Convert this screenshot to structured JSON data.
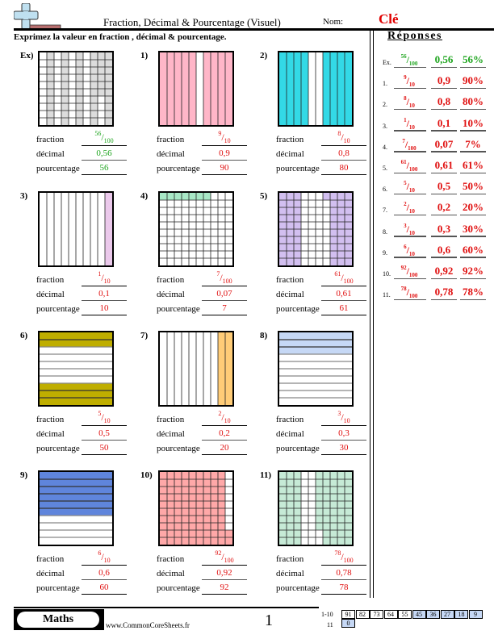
{
  "header": {
    "title": "Fraction, Décimal & Pourcentage (Visuel)",
    "nom_label": "Nom:",
    "nom_value": "Clé",
    "instructions": "Exprimez la valeur en fraction , décimal & pourcentage.",
    "logo_icon": "plus-minus-logo-icon"
  },
  "labels": {
    "fraction": "fraction",
    "decimal": "décimal",
    "pourcentage": "pourcentage"
  },
  "problems": [
    {
      "num": "Ex)",
      "type": "grid100",
      "color": "#dcdcdc",
      "shaded_cols_full": [
        1,
        3,
        5,
        7,
        9
      ],
      "partial": {
        "col": 8,
        "rows": [
          0,
          1,
          2,
          3,
          4,
          5
        ]
      },
      "num_txt": "56",
      "den_txt": "100",
      "decimal": "0,56",
      "percent": "56",
      "answer_color": "green"
    },
    {
      "num": "1)",
      "type": "cols10",
      "color": "#ffb6c8",
      "shaded": [
        0,
        1,
        2,
        3,
        4,
        6,
        7,
        8,
        9
      ],
      "num_txt": "9",
      "den_txt": "10",
      "decimal": "0,9",
      "percent": "90",
      "answer_color": "red"
    },
    {
      "num": "2)",
      "type": "cols10",
      "color": "#33d9e6",
      "shaded": [
        0,
        1,
        2,
        3,
        6,
        7,
        8,
        9
      ],
      "num_txt": "8",
      "den_txt": "10",
      "decimal": "0,8",
      "percent": "80",
      "answer_color": "red"
    },
    {
      "num": "3)",
      "type": "cols10",
      "color": "#ebc9eb",
      "shaded": [
        9
      ],
      "num_txt": "1",
      "den_txt": "10",
      "decimal": "0,1",
      "percent": "10",
      "answer_color": "red"
    },
    {
      "num": "4)",
      "type": "grid100",
      "color": "#a8e8c6",
      "shaded_cols_full": [],
      "cells": [
        [
          0,
          0
        ],
        [
          0,
          1
        ],
        [
          0,
          2
        ],
        [
          0,
          3
        ],
        [
          0,
          4
        ],
        [
          0,
          5
        ],
        [
          0,
          6
        ]
      ],
      "num_txt": "7",
      "den_txt": "100",
      "decimal": "0,07",
      "percent": "7",
      "answer_color": "red"
    },
    {
      "num": "5)",
      "type": "grid100",
      "color": "#d2bff0",
      "shaded_cols_full": [
        0,
        1,
        2,
        7,
        8,
        9
      ],
      "partial": {
        "col": 6,
        "rows": [
          0
        ]
      },
      "num_txt": "61",
      "den_txt": "100",
      "decimal": "0,61",
      "percent": "61",
      "answer_color": "red"
    },
    {
      "num": "6)",
      "type": "rows10",
      "color": "#bfae00",
      "shaded": [
        0,
        1,
        7,
        8,
        9
      ],
      "num_txt": "5",
      "den_txt": "10",
      "decimal": "0,5",
      "percent": "50",
      "answer_color": "red"
    },
    {
      "num": "7)",
      "type": "cols10",
      "color": "#ffcc77",
      "shaded": [
        8,
        9
      ],
      "num_txt": "2",
      "den_txt": "10",
      "decimal": "0,2",
      "percent": "20",
      "answer_color": "red"
    },
    {
      "num": "8)",
      "type": "rows10",
      "color": "#c6d8f5",
      "shaded": [
        0,
        1,
        2
      ],
      "num_txt": "3",
      "den_txt": "10",
      "decimal": "0,3",
      "percent": "30",
      "answer_color": "red"
    },
    {
      "num": "9)",
      "type": "rows10",
      "color": "#5f85dc",
      "shaded": [
        0,
        1,
        2,
        3,
        4,
        5
      ],
      "num_txt": "6",
      "den_txt": "10",
      "decimal": "0,6",
      "percent": "60",
      "answer_color": "red"
    },
    {
      "num": "10)",
      "type": "grid100",
      "color": "#ffa8a8",
      "shaded_cols_full": [
        0,
        1,
        2,
        3,
        4,
        5,
        6,
        7,
        8
      ],
      "partial": {
        "col": 9,
        "rows": [
          8,
          9
        ]
      },
      "num_txt": "92",
      "den_txt": "100",
      "decimal": "0,92",
      "percent": "92",
      "answer_color": "red"
    },
    {
      "num": "11)",
      "type": "grid100",
      "color": "#c6ead6",
      "shaded_cols_full": [
        0,
        1,
        2,
        6,
        7,
        8,
        9
      ],
      "partial": {
        "col": 5,
        "rows": [
          0,
          1,
          2,
          3,
          4,
          5,
          6,
          7
        ]
      },
      "num_txt": "78",
      "den_txt": "100",
      "decimal": "0,78",
      "percent": "78",
      "answer_color": "red"
    }
  ],
  "answers": {
    "title": "Réponses",
    "items": [
      {
        "no": "Ex.",
        "n": "56",
        "d": "100",
        "decimal": "0,56",
        "percent": "56%",
        "color": "green"
      },
      {
        "no": "1.",
        "n": "9",
        "d": "10",
        "decimal": "0,9",
        "percent": "90%",
        "color": "red"
      },
      {
        "no": "2.",
        "n": "8",
        "d": "10",
        "decimal": "0,8",
        "percent": "80%",
        "color": "red"
      },
      {
        "no": "3.",
        "n": "1",
        "d": "10",
        "decimal": "0,1",
        "percent": "10%",
        "color": "red"
      },
      {
        "no": "4.",
        "n": "7",
        "d": "100",
        "decimal": "0,07",
        "percent": "7%",
        "color": "red"
      },
      {
        "no": "5.",
        "n": "61",
        "d": "100",
        "decimal": "0,61",
        "percent": "61%",
        "color": "red"
      },
      {
        "no": "6.",
        "n": "5",
        "d": "10",
        "decimal": "0,5",
        "percent": "50%",
        "color": "red"
      },
      {
        "no": "7.",
        "n": "2",
        "d": "10",
        "decimal": "0,2",
        "percent": "20%",
        "color": "red"
      },
      {
        "no": "8.",
        "n": "3",
        "d": "10",
        "decimal": "0,3",
        "percent": "30%",
        "color": "red"
      },
      {
        "no": "9.",
        "n": "6",
        "d": "10",
        "decimal": "0,6",
        "percent": "60%",
        "color": "red"
      },
      {
        "no": "10.",
        "n": "92",
        "d": "100",
        "decimal": "0,92",
        "percent": "92%",
        "color": "red"
      },
      {
        "no": "11.",
        "n": "78",
        "d": "100",
        "decimal": "0,78",
        "percent": "78%",
        "color": "red"
      }
    ]
  },
  "footer": {
    "subject": "Maths",
    "site": "www.CommonCoreSheets.fr",
    "page": "1",
    "score_range_1": "1-10",
    "score_range_2": "11",
    "scores_row1": [
      {
        "v": "91",
        "hl": false
      },
      {
        "v": "82",
        "hl": false
      },
      {
        "v": "73",
        "hl": false
      },
      {
        "v": "64",
        "hl": false
      },
      {
        "v": "55",
        "hl": false
      },
      {
        "v": "45",
        "hl": true
      },
      {
        "v": "36",
        "hl": true
      },
      {
        "v": "27",
        "hl": true
      },
      {
        "v": "18",
        "hl": true
      },
      {
        "v": "9",
        "hl": true
      }
    ],
    "scores_row2": [
      {
        "v": "0",
        "hl": true
      }
    ]
  }
}
